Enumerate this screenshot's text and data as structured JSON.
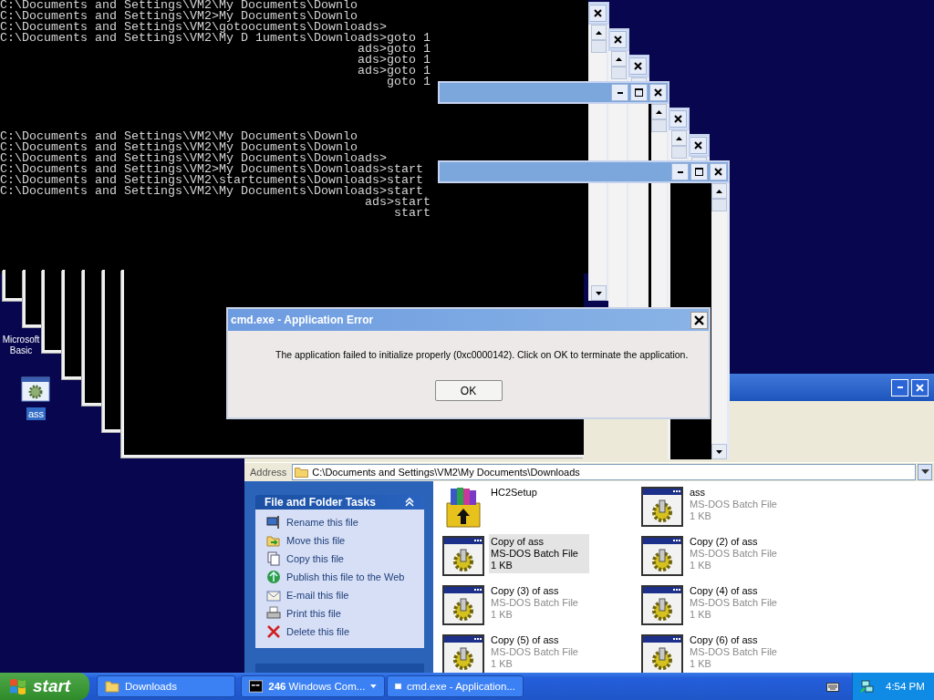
{
  "desktop_icons": [
    {
      "kind": "label-only",
      "label": "Microsoft Basic",
      "selected": false
    },
    {
      "kind": "batch",
      "label": "ass",
      "selected": true
    }
  ],
  "console": {
    "blocks": [
      {
        "lines": [
          {
            "kind": "full",
            "text": "C:\\Documents and Settings\\VM2\\My Documents\\Downlo"
          },
          {
            "kind": "full",
            "text": "C:\\Documents and Settings\\VM2>My Documents\\Downlo"
          },
          {
            "kind": "full",
            "text": "C:\\Documents and Settings\\VM2\\gotoocuments\\Downloads>"
          },
          {
            "kind": "full",
            "text": "C:\\Documents and Settings\\VM2\\My D 1uments\\Downloads>goto 1"
          },
          {
            "kind": "tail",
            "text": "ads>goto 1"
          },
          {
            "kind": "tail",
            "text": "ads>goto 1"
          },
          {
            "kind": "tail",
            "text": "ads>goto 1"
          },
          {
            "kind": "tail",
            "text": "goto 1"
          }
        ]
      },
      {
        "lines": [
          {
            "kind": "full",
            "text": "C:\\Documents and Settings\\VM2\\My Documents\\Downlo"
          },
          {
            "kind": "full",
            "text": "C:\\Documents and Settings\\VM2\\My Documents\\Downlo"
          },
          {
            "kind": "full",
            "text": "C:\\Documents and Settings\\VM2\\My Documents\\Downloads>"
          },
          {
            "kind": "full",
            "text": "C:\\Documents and Settings\\VM2>My Documents\\Downloads>start"
          },
          {
            "kind": "full",
            "text": "C:\\Documents and Settings\\VM2\\startcuments\\Downloads>start"
          },
          {
            "kind": "full",
            "text": "C:\\Documents and Settings\\VM2\\My Documents\\Downloads>start"
          },
          {
            "kind": "tail",
            "text": "ads>start"
          },
          {
            "kind": "tail",
            "text": "start"
          }
        ]
      }
    ]
  },
  "stacked_windows": [
    {
      "active": false
    },
    {
      "active": false
    },
    {
      "active": false
    },
    {
      "active": true
    },
    {
      "active": false
    },
    {
      "active": false
    },
    {
      "active": true
    }
  ],
  "error_dialog": {
    "title": "cmd.exe - Application Error",
    "message": "The application failed to initialize properly (0xc0000142). Click on OK to terminate the application.",
    "button": "OK"
  },
  "explorer": {
    "address_label": "Address",
    "address": "C:\\Documents and Settings\\VM2\\My Documents\\Downloads",
    "tasks_title": "File and Folder Tasks",
    "tasks": [
      {
        "kind": "rename",
        "label": "Rename this file"
      },
      {
        "kind": "move",
        "label": "Move this file"
      },
      {
        "kind": "copy",
        "label": "Copy this file"
      },
      {
        "kind": "publish",
        "label": "Publish this file to the Web"
      },
      {
        "kind": "email",
        "label": "E-mail this file"
      },
      {
        "kind": "print",
        "label": "Print this file"
      },
      {
        "kind": "delete",
        "label": "Delete this file"
      }
    ],
    "files": [
      {
        "kind": "installer",
        "name": "HC2Setup",
        "selected": false
      },
      {
        "kind": "batch",
        "name": "ass",
        "type": "MS-DOS Batch File",
        "size": "1 KB",
        "selected": false
      },
      {
        "kind": "batch",
        "name": "Copy of ass",
        "type": "MS-DOS Batch File",
        "size": "1 KB",
        "selected": true
      },
      {
        "kind": "batch",
        "name": "Copy (2) of ass",
        "type": "MS-DOS Batch File",
        "size": "1 KB",
        "selected": false
      },
      {
        "kind": "batch",
        "name": "Copy (3) of ass",
        "type": "MS-DOS Batch File",
        "size": "1 KB",
        "selected": false
      },
      {
        "kind": "batch",
        "name": "Copy (4) of ass",
        "type": "MS-DOS Batch File",
        "size": "1 KB",
        "selected": false
      },
      {
        "kind": "batch",
        "name": "Copy (5) of ass",
        "type": "MS-DOS Batch File",
        "size": "1 KB",
        "selected": false
      },
      {
        "kind": "batch",
        "name": "Copy (6) of ass",
        "type": "MS-DOS Batch File",
        "size": "1 KB",
        "selected": false
      }
    ]
  },
  "taskbar": {
    "start": "start",
    "items": [
      {
        "kind": "folder",
        "label": "Downloads"
      },
      {
        "kind": "group",
        "label": "**246** Windows Com..."
      },
      {
        "kind": "window",
        "label": "cmd.exe - Application..."
      }
    ],
    "clock": "4:54 PM"
  }
}
